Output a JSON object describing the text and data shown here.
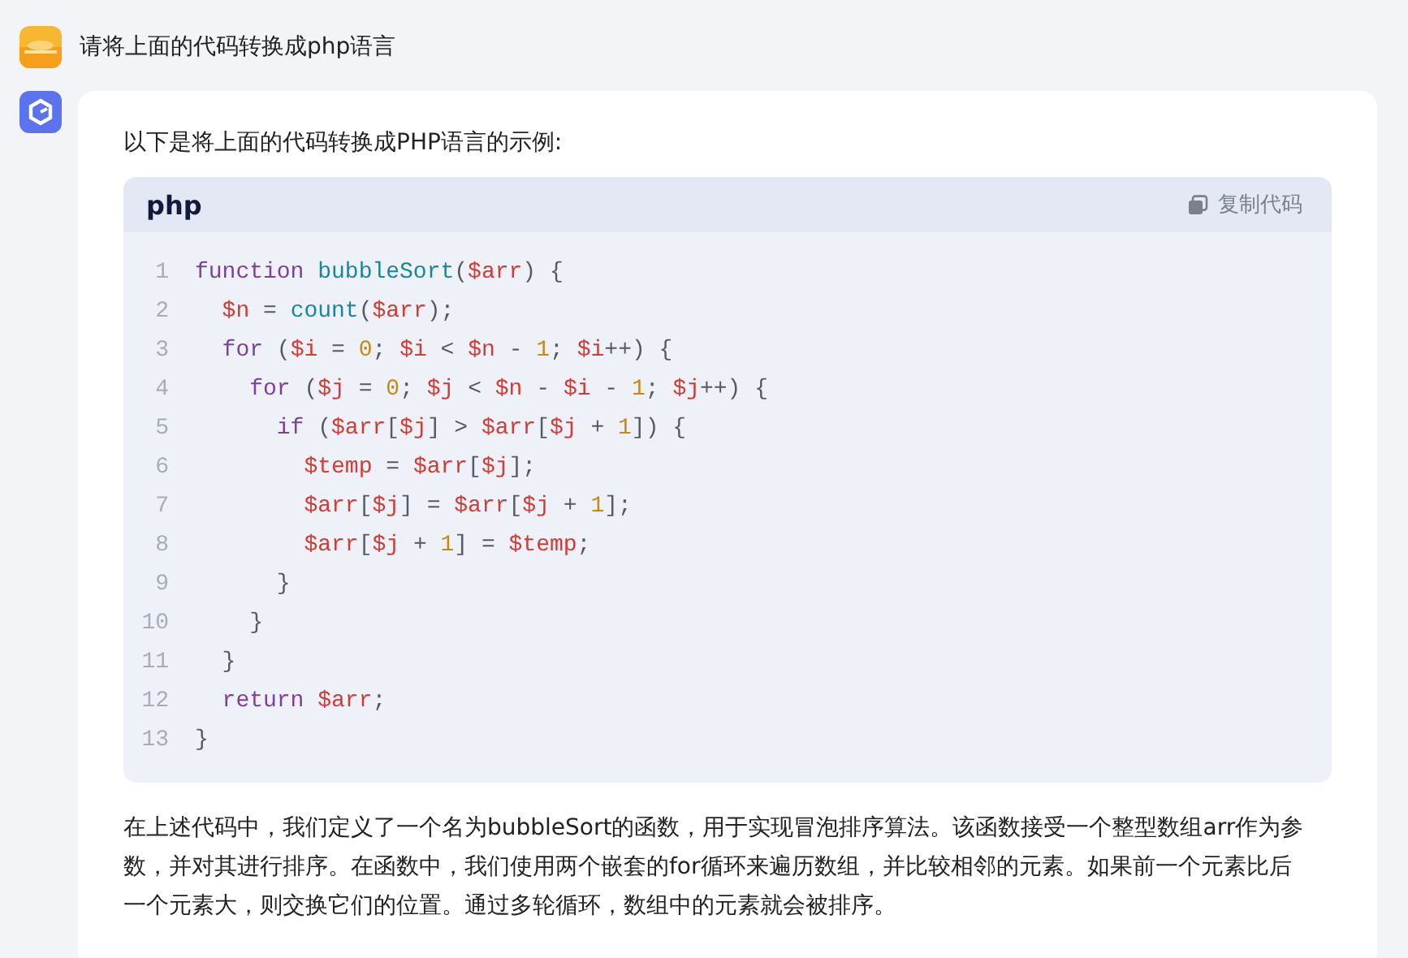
{
  "user_message": {
    "text": "请将上面的代码转换成php语言"
  },
  "answer": {
    "intro": "以下是将上面的代码转换成PHP语言的示例:",
    "code_block": {
      "language": "php",
      "copy_button": "复制代码",
      "lines": [
        {
          "number": "1",
          "tokens": [
            {
              "kind": "keyword",
              "text": "function"
            },
            {
              "kind": "function",
              "text": " bubbleSort"
            },
            {
              "kind": "plain",
              "text": "("
            },
            {
              "kind": "variable",
              "text": "$arr"
            },
            {
              "kind": "plain",
              "text": ") {"
            }
          ]
        },
        {
          "number": "2",
          "tokens": [
            {
              "kind": "variable",
              "text": "  $n"
            },
            {
              "kind": "plain",
              "text": " = "
            },
            {
              "kind": "function",
              "text": "count"
            },
            {
              "kind": "plain",
              "text": "("
            },
            {
              "kind": "variable",
              "text": "$arr"
            },
            {
              "kind": "plain",
              "text": ");"
            }
          ]
        },
        {
          "number": "3",
          "tokens": [
            {
              "kind": "keyword",
              "text": "  for"
            },
            {
              "kind": "plain",
              "text": " ("
            },
            {
              "kind": "variable",
              "text": "$i"
            },
            {
              "kind": "plain",
              "text": " = "
            },
            {
              "kind": "number",
              "text": "0"
            },
            {
              "kind": "plain",
              "text": "; "
            },
            {
              "kind": "variable",
              "text": "$i"
            },
            {
              "kind": "plain",
              "text": " < "
            },
            {
              "kind": "variable",
              "text": "$n"
            },
            {
              "kind": "plain",
              "text": " - "
            },
            {
              "kind": "number",
              "text": "1"
            },
            {
              "kind": "plain",
              "text": "; "
            },
            {
              "kind": "variable",
              "text": "$i"
            },
            {
              "kind": "plain",
              "text": "++) {"
            }
          ]
        },
        {
          "number": "4",
          "tokens": [
            {
              "kind": "keyword",
              "text": "    for"
            },
            {
              "kind": "plain",
              "text": " ("
            },
            {
              "kind": "variable",
              "text": "$j"
            },
            {
              "kind": "plain",
              "text": " = "
            },
            {
              "kind": "number",
              "text": "0"
            },
            {
              "kind": "plain",
              "text": "; "
            },
            {
              "kind": "variable",
              "text": "$j"
            },
            {
              "kind": "plain",
              "text": " < "
            },
            {
              "kind": "variable",
              "text": "$n"
            },
            {
              "kind": "plain",
              "text": " - "
            },
            {
              "kind": "variable",
              "text": "$i"
            },
            {
              "kind": "plain",
              "text": " - "
            },
            {
              "kind": "number",
              "text": "1"
            },
            {
              "kind": "plain",
              "text": "; "
            },
            {
              "kind": "variable",
              "text": "$j"
            },
            {
              "kind": "plain",
              "text": "++) {"
            }
          ]
        },
        {
          "number": "5",
          "tokens": [
            {
              "kind": "keyword",
              "text": "      if"
            },
            {
              "kind": "plain",
              "text": " ("
            },
            {
              "kind": "variable",
              "text": "$arr"
            },
            {
              "kind": "plain",
              "text": "["
            },
            {
              "kind": "variable",
              "text": "$j"
            },
            {
              "kind": "plain",
              "text": "] > "
            },
            {
              "kind": "variable",
              "text": "$arr"
            },
            {
              "kind": "plain",
              "text": "["
            },
            {
              "kind": "variable",
              "text": "$j"
            },
            {
              "kind": "plain",
              "text": " + "
            },
            {
              "kind": "number",
              "text": "1"
            },
            {
              "kind": "plain",
              "text": "]) {"
            }
          ]
        },
        {
          "number": "6",
          "tokens": [
            {
              "kind": "variable",
              "text": "        $temp"
            },
            {
              "kind": "plain",
              "text": " = "
            },
            {
              "kind": "variable",
              "text": "$arr"
            },
            {
              "kind": "plain",
              "text": "["
            },
            {
              "kind": "variable",
              "text": "$j"
            },
            {
              "kind": "plain",
              "text": "];"
            }
          ]
        },
        {
          "number": "7",
          "tokens": [
            {
              "kind": "variable",
              "text": "        $arr"
            },
            {
              "kind": "plain",
              "text": "["
            },
            {
              "kind": "variable",
              "text": "$j"
            },
            {
              "kind": "plain",
              "text": "] = "
            },
            {
              "kind": "variable",
              "text": "$arr"
            },
            {
              "kind": "plain",
              "text": "["
            },
            {
              "kind": "variable",
              "text": "$j"
            },
            {
              "kind": "plain",
              "text": " + "
            },
            {
              "kind": "number",
              "text": "1"
            },
            {
              "kind": "plain",
              "text": "];"
            }
          ]
        },
        {
          "number": "8",
          "tokens": [
            {
              "kind": "variable",
              "text": "        $arr"
            },
            {
              "kind": "plain",
              "text": "["
            },
            {
              "kind": "variable",
              "text": "$j"
            },
            {
              "kind": "plain",
              "text": " + "
            },
            {
              "kind": "number",
              "text": "1"
            },
            {
              "kind": "plain",
              "text": "] = "
            },
            {
              "kind": "variable",
              "text": "$temp"
            },
            {
              "kind": "plain",
              "text": ";"
            }
          ]
        },
        {
          "number": "9",
          "tokens": [
            {
              "kind": "plain",
              "text": "      }"
            }
          ]
        },
        {
          "number": "10",
          "tokens": [
            {
              "kind": "plain",
              "text": "    }"
            }
          ]
        },
        {
          "number": "11",
          "tokens": [
            {
              "kind": "plain",
              "text": "  }"
            }
          ]
        },
        {
          "number": "12",
          "tokens": [
            {
              "kind": "keyword",
              "text": "  return"
            },
            {
              "kind": "variable",
              "text": " $arr"
            },
            {
              "kind": "plain",
              "text": ";"
            }
          ]
        },
        {
          "number": "13",
          "tokens": [
            {
              "kind": "plain",
              "text": "}"
            }
          ]
        }
      ]
    },
    "explanation": "在上述代码中，我们定义了一个名为bubbleSort的函数，用于实现冒泡排序算法。该函数接受一个整型数组arr作为参数，并对其进行排序。在函数中，我们使用两个嵌套的for循环来遍历数组，并比较相邻的元素。如果前一个元素比后一个元素大，则交换它们的位置。通过多轮循环，数组中的元素就会被排序。"
  }
}
